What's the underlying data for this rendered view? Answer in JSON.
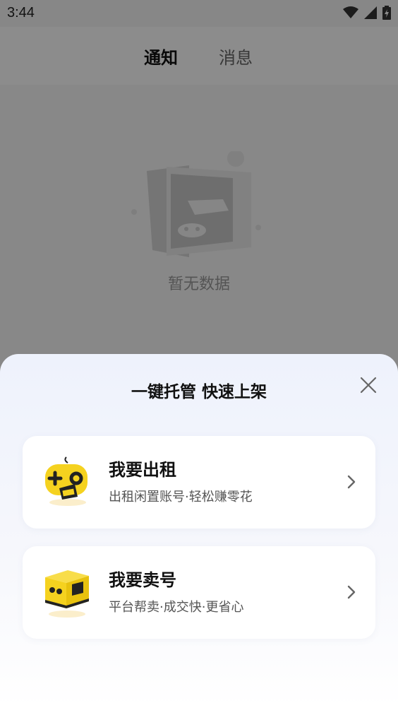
{
  "status_bar": {
    "time": "3:44",
    "icons": [
      "wifi-icon",
      "signal-icon",
      "battery-charging-icon"
    ]
  },
  "tabs": [
    {
      "label": "通知",
      "active": true
    },
    {
      "label": "消息",
      "active": false
    }
  ],
  "empty_state": {
    "text": "暂无数据",
    "icon": "empty-box-illustration"
  },
  "sheet": {
    "title": "一键托管 快速上架",
    "options": [
      {
        "title": "我要出租",
        "subtitle": "出租闲置账号·轻松赚零花",
        "icon": "gamepad-rent-icon"
      },
      {
        "title": "我要卖号",
        "subtitle": "平台帮卖·成交快·更省心",
        "icon": "box-sell-icon"
      }
    ]
  },
  "colors": {
    "accent_yellow": "#f5d21f",
    "sheet_bg": "#eef2fc",
    "overlay": "rgba(0,0,0,0.45)"
  }
}
